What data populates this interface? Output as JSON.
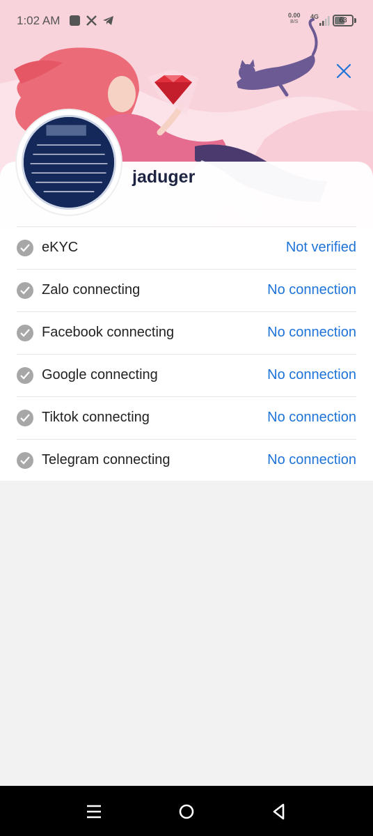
{
  "status_bar": {
    "time": "1:02 AM",
    "net_speed_value": "0.00",
    "net_speed_unit": "B/S",
    "net_type": "4G",
    "battery_level": "63",
    "battery_fraction": 0.63,
    "notification_icons": [
      "app-square-icon",
      "x-logo-icon",
      "telegram-icon"
    ]
  },
  "header": {
    "close_icon": "close-icon"
  },
  "profile": {
    "username": "jaduger"
  },
  "connections": [
    {
      "label": "eKYC",
      "status": "Not verified"
    },
    {
      "label": "Zalo connecting",
      "status": "No connection"
    },
    {
      "label": "Facebook connecting",
      "status": "No connection"
    },
    {
      "label": "Google connecting",
      "status": "No connection"
    },
    {
      "label": "Tiktok connecting",
      "status": "No connection"
    },
    {
      "label": "Telegram connecting",
      "status": "No connection"
    }
  ],
  "nav": {
    "icons": [
      "menu-icon",
      "home-icon",
      "back-icon"
    ]
  },
  "colors": {
    "accent": "#1e73d8",
    "hero_bg": "#f9d3dc",
    "text_dark": "#1d2340"
  }
}
